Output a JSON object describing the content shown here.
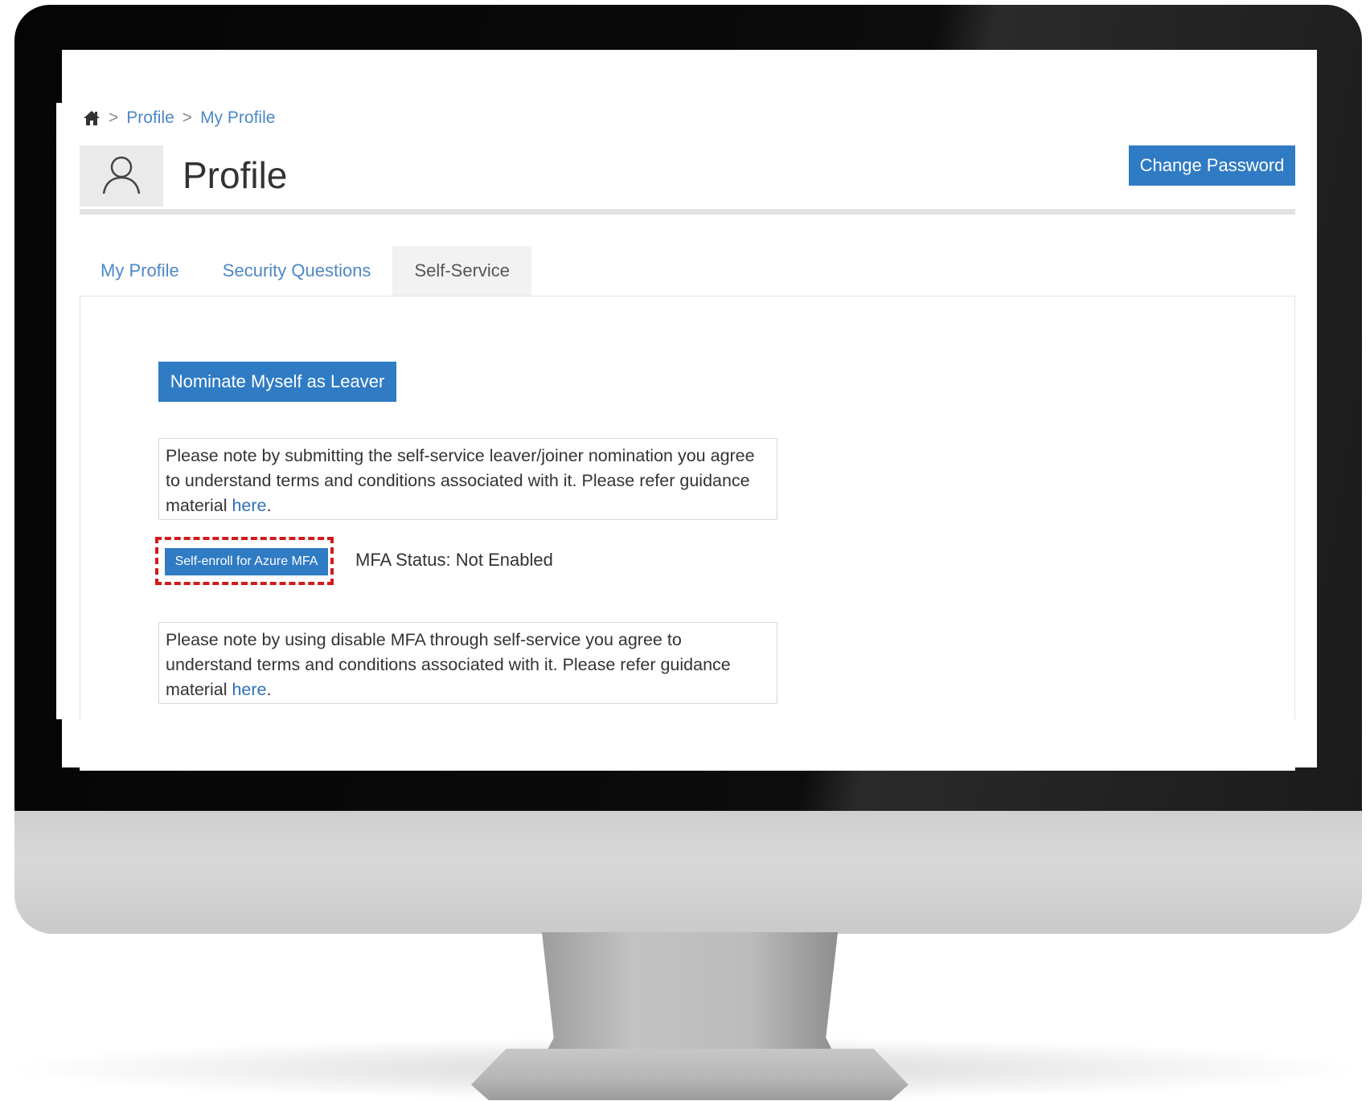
{
  "breadcrumb": {
    "home_icon": "home-icon",
    "separator": ">",
    "items": [
      "Profile",
      "My Profile"
    ]
  },
  "header": {
    "avatar_icon": "user-icon",
    "title": "Profile",
    "change_password_label": "Change Password"
  },
  "tabs": [
    {
      "label": "My Profile",
      "active": false
    },
    {
      "label": "Security Questions",
      "active": false
    },
    {
      "label": "Self-Service",
      "active": true
    }
  ],
  "self_service": {
    "nominate_label": "Nominate Myself as Leaver",
    "notice_1": {
      "text": "Please note by submitting the self-service leaver/joiner nomination you agree to understand terms and conditions associated with it. Please refer guidance material ",
      "link": "here",
      "suffix": "."
    },
    "mfa_button_label": "Self-enroll for Azure MFA",
    "mfa_status": "MFA Status: Not Enabled",
    "notice_2": {
      "text": "Please note by using disable MFA through self-service you agree to understand terms and conditions associated with it. Please refer guidance material ",
      "link": "here",
      "suffix": "."
    }
  },
  "colors": {
    "primary_button": "#2f7bc4",
    "link": "#4e87c6",
    "highlight_dashed": "#d01b1b"
  }
}
